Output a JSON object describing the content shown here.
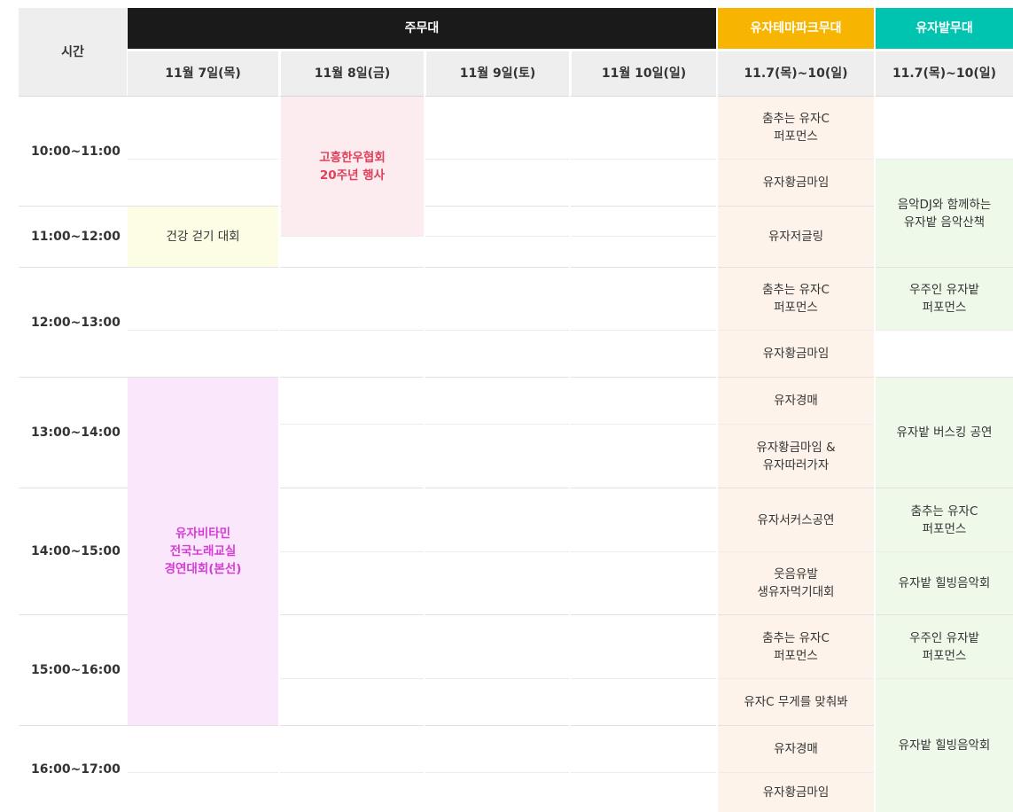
{
  "header": {
    "time": "시간",
    "main_stage": "주무대",
    "theme_stage": "유자테마파크무대",
    "field_stage": "유자밭무대",
    "day1": "11월 7일(목)",
    "day2": "11월 8일(금)",
    "day3": "11월 9일(토)",
    "day4": "11월 10일(일)",
    "theme_range": "11.7(목)~10(일)",
    "field_range": "11.7(목)~10(일)"
  },
  "times": [
    "10:00~11:00",
    "11:00~12:00",
    "12:00~13:00",
    "13:00~14:00",
    "14:00~15:00",
    "15:00~16:00",
    "16:00~17:00"
  ],
  "main_events": {
    "walking": "건강 걷기 대회",
    "hanwoo": "고흥한우협회\n20주년 행사",
    "vitamin": "유자비타민\n전국노래교실\n경연대회(본선)"
  },
  "theme_events": [
    "춤추는 유자C\n퍼포먼스",
    "유자황금마임",
    "유자저글링",
    "춤추는 유자C\n퍼포먼스",
    "유자황금마임",
    "유자경매",
    "유자황금마임 &\n유자따러가자",
    "유자서커스공연",
    "웃음유발\n생유자먹기대회",
    "춤추는 유자C\n퍼포먼스",
    "유자C 무게를 맞춰봐",
    "유자경매",
    "유자황금마임"
  ],
  "field_events": [
    "음악DJ와 함께하는\n유자밭 음악산책",
    "우주인 유자밭\n퍼포먼스",
    "유자밭 버스킹 공연",
    "춤추는 유자C\n퍼포먼스",
    "유자밭 힐빙음악회",
    "우주인 유자밭\n퍼포먼스",
    "유자밭 힐빙음악회"
  ],
  "colors": {
    "main_header_bg": "#1a1a1a",
    "theme_header_bg": "#f7b400",
    "field_header_bg": "#00c4b0",
    "subheader_bg": "#eeeeee",
    "theme_col_bg": "#fdf3ea",
    "field_col_bg": "#eef9ea",
    "walking_bg": "#fdfde6",
    "hanwoo_bg": "#fdecef",
    "hanwoo_text": "#e0405a",
    "vitamin_bg": "#fbe7fb",
    "vitamin_text": "#d43ed4"
  }
}
